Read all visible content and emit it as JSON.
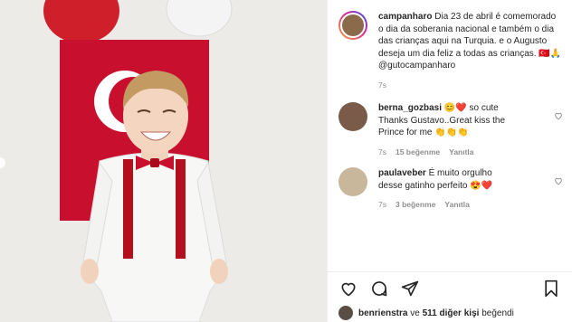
{
  "post": {
    "author": "campanharo",
    "caption": "Dia 23 de abril é comemorado o dia da soberania nacional e também o dia das crianças aqui na Turquia. e o Augusto deseja um dia feliz a todas as crianças. 🇹🇷🙏",
    "mention": "@gutocampanharo",
    "time": "7s"
  },
  "comments": [
    {
      "user": "berna_gozbasi",
      "text_line1": "😊❤️ so cute",
      "text_line2": "Thanks Gustavo..Great kiss the",
      "text_line3": "Prince for me 👏👏👏",
      "time": "7s",
      "likes": "15 beğenme",
      "reply": "Yanıtla"
    },
    {
      "user": "paulaveber",
      "text_line1": "É muito orgulho",
      "text_line2": "desse gatinho perfeito 😍❤️",
      "time": "7s",
      "likes": "3 beğenme",
      "reply": "Yanıtla"
    }
  ],
  "likes_line": {
    "user": "benrienstra",
    "connector": "ve",
    "others": "511 diğer kişi",
    "suffix": "beğendi"
  },
  "colors": {
    "flag_red": "#c8102e",
    "heart_red": "#e0245e",
    "meta_gray": "#8e8e8e",
    "text_dark": "#262626"
  }
}
